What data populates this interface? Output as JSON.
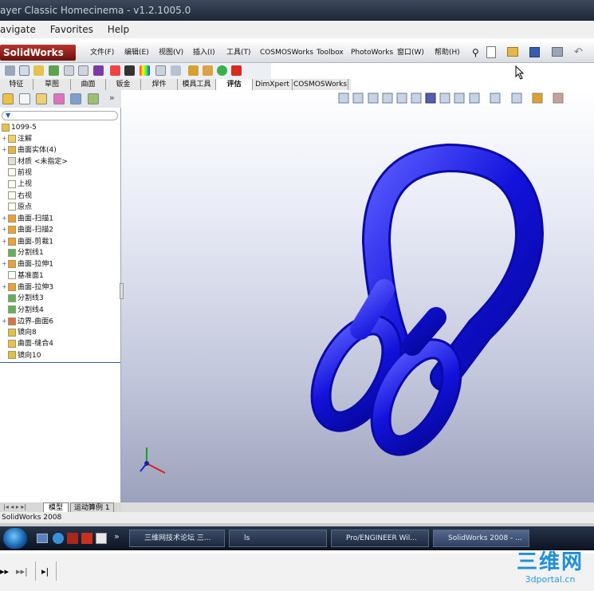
{
  "window_title": "ayer Classic Homecinema - v1.2.1005.0",
  "player_menu": [
    "avigate",
    "Favorites",
    "Help"
  ],
  "sw": {
    "logo": "SolidWorks",
    "menu": [
      "文件(F)",
      "编辑(E)",
      "视图(V)",
      "插入(I)",
      "工具(T)",
      "COSMOSWorks",
      "Toolbox",
      "PhotoWorks",
      "窗口(W)",
      "帮助(H)"
    ]
  },
  "command_tabs": [
    "特征",
    "草图",
    "曲面",
    "钣金",
    "焊件",
    "模具工具",
    "评估",
    "DimXpert",
    "COSMOSWorks"
  ],
  "active_tab_index": 6,
  "tree": {
    "root": "1099-5",
    "items": [
      {
        "label": "注解",
        "expand": "+"
      },
      {
        "label": "曲面实体(4)",
        "expand": "+"
      },
      {
        "label": "材质 <未指定>",
        "expand": ""
      },
      {
        "label": "前视",
        "expand": ""
      },
      {
        "label": "上视",
        "expand": ""
      },
      {
        "label": "右视",
        "expand": ""
      },
      {
        "label": "原点",
        "expand": ""
      },
      {
        "label": "曲面-扫描1",
        "expand": "+"
      },
      {
        "label": "曲面-扫描2",
        "expand": "+"
      },
      {
        "label": "曲面-剪裁1",
        "expand": "+"
      },
      {
        "label": "分割线1",
        "expand": ""
      },
      {
        "label": "曲面-拉伸1",
        "expand": "+"
      },
      {
        "label": "基准面1",
        "expand": ""
      },
      {
        "label": "曲面-拉伸3",
        "expand": "+"
      },
      {
        "label": "分割线3",
        "expand": ""
      },
      {
        "label": "分割线4",
        "expand": ""
      },
      {
        "label": "边界-曲面6",
        "expand": "+"
      },
      {
        "label": "镜向8",
        "expand": ""
      },
      {
        "label": "曲面-缝合4",
        "expand": ""
      },
      {
        "label": "镜向10",
        "expand": ""
      }
    ]
  },
  "bottom_tabs": [
    "模型",
    "运动算例 1"
  ],
  "status_text": "SolidWorks 2008",
  "taskbar": [
    {
      "label": "三维网技术论坛 三..."
    },
    {
      "label": "ls"
    },
    {
      "label": "Pro/ENGINEER Wil..."
    },
    {
      "label": "SolidWorks 2008 - ..."
    }
  ],
  "watermark": {
    "text": "三维网",
    "url": "3dportal.cn"
  },
  "colors": {
    "model_blue": "#1010d8",
    "sw_red": "#a8281e"
  }
}
